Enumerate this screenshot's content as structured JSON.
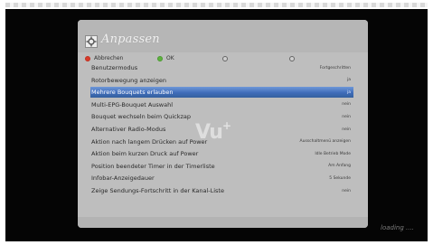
{
  "screen": {
    "title": "Anpassen",
    "loading_text": "loading ....",
    "logo": "Vu",
    "logo_plus": "+"
  },
  "colorbar": {
    "red_label": "Abbrechen",
    "green_label": "OK",
    "yellow_label": "",
    "blue_label": "",
    "colors": {
      "red": "#d83a2a",
      "green": "#5fb23f",
      "yellow": "#c9c9c9",
      "blue": "#c9c9c9"
    }
  },
  "items": [
    {
      "label": "Benutzermodus",
      "value": "Fortgeschritten"
    },
    {
      "label": "Rotorbewegung anzeigen",
      "value": "ja"
    },
    {
      "label": "Mehrere Bouquets erlauben",
      "value": "ja"
    },
    {
      "label": "Multi-EPG-Bouquet Auswahl",
      "value": "nein"
    },
    {
      "label": "Bouquet wechseln beim Quickzap",
      "value": "nein"
    },
    {
      "label": "Alternativer Radio-Modus",
      "value": "nein"
    },
    {
      "label": "Aktion nach langem Drücken auf Power",
      "value": "Ausschaltmenü anzeigen"
    },
    {
      "label": "Aktion beim kurzen Druck auf Power",
      "value": "Idle Betrieb Mode"
    },
    {
      "label": "Position beendeter Timer in der Timerliste",
      "value": "Am Anfang"
    },
    {
      "label": "Infobar-Anzeigedauer",
      "value": "5 Sekunde"
    },
    {
      "label": "Zeige Sendungs-Fortschritt in der Kanal-Liste",
      "value": "nein"
    }
  ],
  "selected_index": 2,
  "accent_color": "#4672c0"
}
